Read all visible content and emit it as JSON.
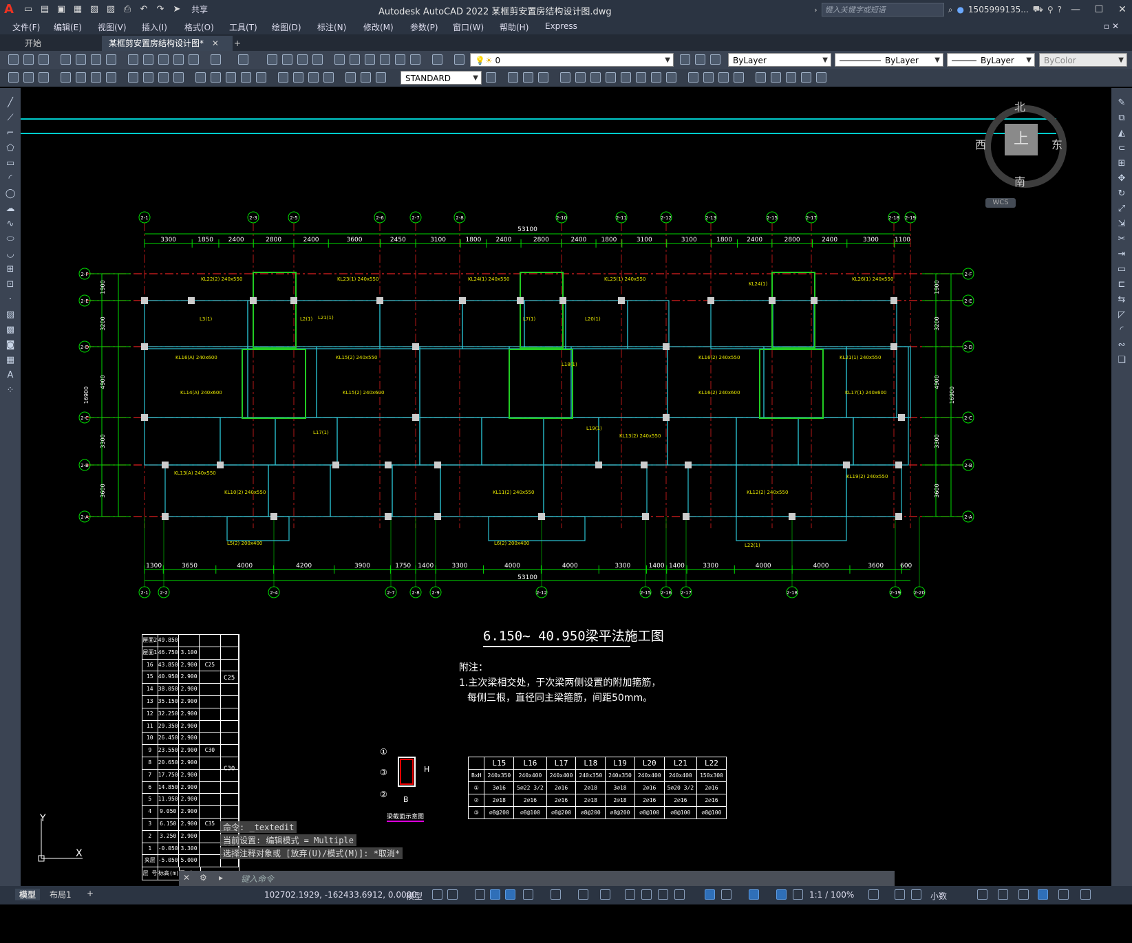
{
  "app": {
    "title": "Autodesk AutoCAD 2022    某框剪安置房结构设计图.dwg",
    "search_placeholder": "键入关键字或短语",
    "user": "1505999135...",
    "share": "共享"
  },
  "menu": [
    "文件(F)",
    "编辑(E)",
    "视图(V)",
    "插入(I)",
    "格式(O)",
    "工具(T)",
    "绘图(D)",
    "标注(N)",
    "修改(M)",
    "参数(P)",
    "窗口(W)",
    "帮助(H)",
    "Express"
  ],
  "tabs": [
    {
      "label": "开始"
    },
    {
      "label": "某框剪安置房结构设计图*"
    }
  ],
  "toolbar": {
    "layer": "0",
    "color": "ByLayer",
    "linetype": "ByLayer",
    "lineweight": "ByLayer",
    "plotstyle": "ByColor",
    "textstyle": "STANDARD"
  },
  "viewcube": {
    "north": "北",
    "south": "南",
    "east": "东",
    "west": "西",
    "top": "上",
    "wcs": "WCS"
  },
  "drawing": {
    "title": "6.150~  40.950梁平法施工图",
    "note_head": "附注：",
    "note_1": "1.主次梁相交处，于次梁两侧设置的附加箍筋，",
    "note_2": "每侧三根，直径同主梁箍筋，间距50mm。",
    "top_axes": [
      "2-1",
      "2-3",
      "2-5",
      "2-6",
      "2-7",
      "2-8",
      "2-10",
      "2-11",
      "2-12",
      "2-13",
      "2-15",
      "2-17",
      "2-18",
      "2-19"
    ],
    "top_dims": [
      "3300",
      "1850",
      "2400",
      "2800",
      "2400",
      "3600",
      "2450",
      "3100",
      "1800",
      "2400",
      "2800",
      "2400",
      "1800",
      "3100",
      "3100",
      "1800",
      "2400",
      "2800",
      "2400",
      "3300",
      "1100"
    ],
    "total": "53100",
    "bottom_axes": [
      "2-1",
      "2-2",
      "2-4",
      "2-7",
      "2-8",
      "2-9",
      "2-12",
      "2-15",
      "2-16",
      "2-17",
      "2-18",
      "2-19",
      "2-20"
    ],
    "bottom_dims": [
      "1300",
      "3650",
      "4000",
      "4200",
      "3900",
      "1750",
      "1400",
      "3300",
      "4000",
      "4000",
      "3300",
      "1400",
      "1400",
      "3300",
      "4000",
      "4000",
      "3600",
      "600"
    ],
    "left_axes": [
      "2-F",
      "2-E",
      "2-D",
      "2-C",
      "2-B",
      "2-A"
    ],
    "left_dims": [
      "1900",
      "3200",
      "4900",
      "3300",
      "3600"
    ],
    "left_total": "16900",
    "beams": [
      "KL22(2) 240x550",
      "KL23(1) 240x550",
      "KL24(1) 240x550",
      "KL25(1) 240x550",
      "KL24(1)",
      "KL26(1) 240x550",
      "KL16(A) 240x600",
      "KL15(2) 240x550",
      "KL16(2) 240x550",
      "KL21(1) 240x550",
      "KL14(A) 240x600",
      "KL15(2) 240x600",
      "KL16(2) 240x600",
      "KL17(1) 240x600",
      "KL13(A) 240x550",
      "KL10(2) 240x550",
      "KL11(2) 240x550",
      "KL12(2) 240x550",
      "KL13(2) 240x550",
      "KL19(2) 240x550",
      "L5(2) 200x400",
      "L6(2) 200x400",
      "L22(1)",
      "L3(1)",
      "L2(1)",
      "L7(1)",
      "L18(1)",
      "L19(1)",
      "L17(1)",
      "L20(1)",
      "L21(1)"
    ],
    "floor_table": {
      "rows": [
        [
          "屋面2",
          "49.850",
          "",
          ""
        ],
        [
          "屋面1",
          "46.750",
          "3.100",
          ""
        ],
        [
          "16",
          "43.850",
          "2.900",
          "C25"
        ],
        [
          "15",
          "40.950",
          "2.900",
          ""
        ],
        [
          "14",
          "38.050",
          "2.900",
          ""
        ],
        [
          "13",
          "35.150",
          "2.900",
          ""
        ],
        [
          "12",
          "32.250",
          "2.900",
          ""
        ],
        [
          "11",
          "29.350",
          "2.900",
          ""
        ],
        [
          "10",
          "26.450",
          "2.900",
          ""
        ],
        [
          "9",
          "23.550",
          "2.900",
          "C30"
        ],
        [
          "8",
          "20.650",
          "2.900",
          ""
        ],
        [
          "7",
          "17.750",
          "2.900",
          ""
        ],
        [
          "6",
          "14.850",
          "2.900",
          ""
        ],
        [
          "5",
          "11.950",
          "2.900",
          ""
        ],
        [
          "4",
          "9.050",
          "2.900",
          ""
        ],
        [
          "3",
          "6.150",
          "2.900",
          "C35"
        ],
        [
          "2",
          "3.250",
          "2.900",
          ""
        ],
        [
          "1",
          "-0.050",
          "3.300",
          ""
        ],
        [
          "夹层",
          "-5.050",
          "5.000",
          ""
        ]
      ],
      "footer": [
        "层 号",
        "标高(m)",
        "层 高(m)"
      ],
      "concrete_wall": [
        "C25",
        "C30",
        "C35"
      ]
    },
    "beam_table": {
      "header": [
        "",
        "L15",
        "L16",
        "L17",
        "L18",
        "L19",
        "L20",
        "L21",
        "L22"
      ],
      "rows": [
        [
          "BxH",
          "240x350",
          "240x400",
          "240x400",
          "240x350",
          "240x350",
          "240x400",
          "240x400",
          "150x300"
        ],
        [
          "①",
          "3⌀16",
          "5⌀22 3/2",
          "2⌀16",
          "2⌀18",
          "3⌀18",
          "2⌀16",
          "5⌀20 3/2",
          "2⌀16"
        ],
        [
          "②",
          "2⌀18",
          "2⌀16",
          "2⌀16",
          "2⌀18",
          "2⌀18",
          "2⌀16",
          "2⌀16",
          "2⌀16"
        ],
        [
          "③",
          "⌀8@200",
          "⌀8@100",
          "⌀8@200",
          "⌀8@200",
          "⌀8@200",
          "⌀8@100",
          "⌀8@100",
          "⌀8@100"
        ]
      ]
    },
    "section_title": "梁截面示意图",
    "section_b": "B",
    "section_h": "H",
    "section_marks": [
      "①",
      "②",
      "③"
    ]
  },
  "ucs": {
    "x": "X",
    "y": "Y"
  },
  "command": {
    "history": [
      "命令: _textedit",
      "当前设置: 编辑模式 = Multiple",
      "选择注释对象或 [放弃(U)/模式(M)]: *取消*"
    ],
    "placeholder": "键入命令"
  },
  "status": {
    "model_tab": "模型",
    "layout_tab": "布局1",
    "coords": "102702.1929, -162433.6912, 0.0000",
    "space": "模型",
    "scale": "1:1 / 100%",
    "units": "小数"
  }
}
